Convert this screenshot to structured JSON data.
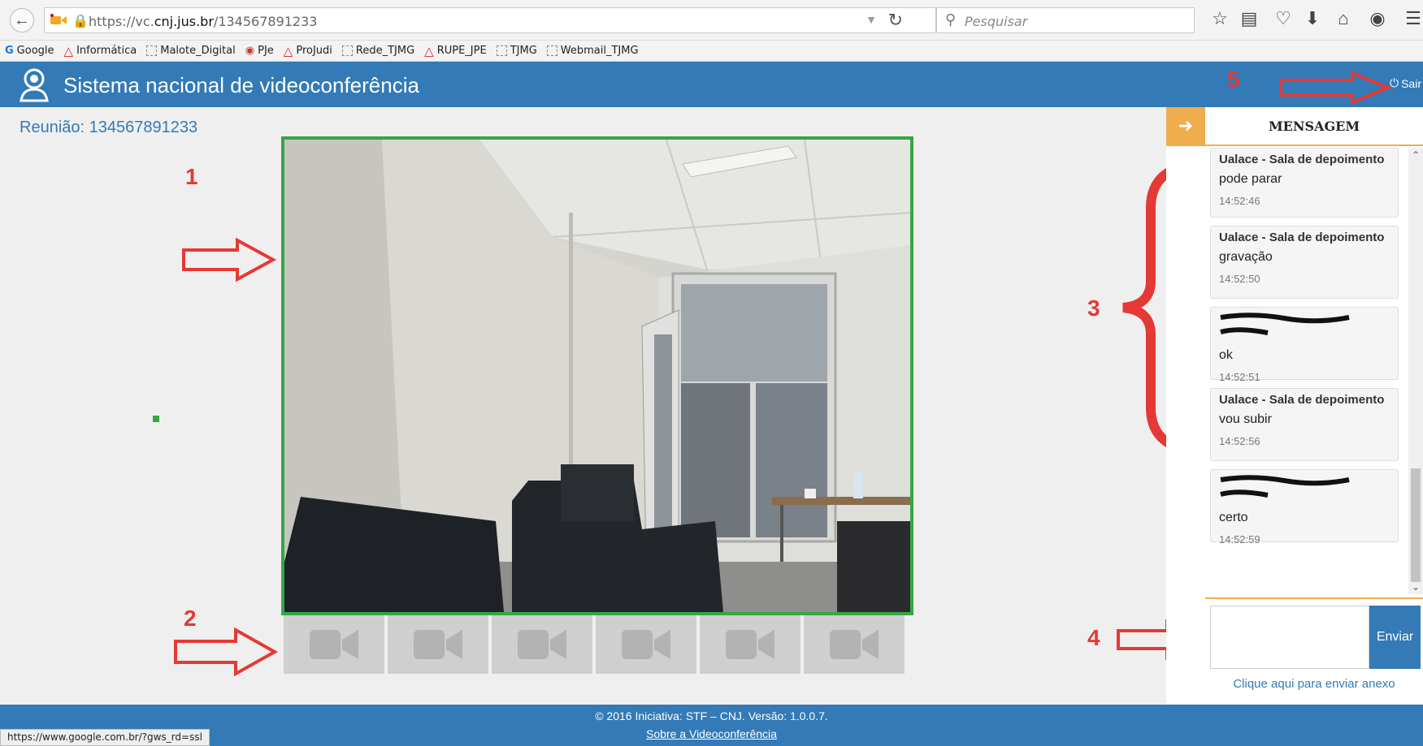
{
  "browser": {
    "url_prefix": "https://vc.",
    "url_domain": "cnj.jus.br",
    "url_path": "/134567891233",
    "search_placeholder": "Pesquisar",
    "status_url": "https://www.google.com.br/?gws_rd=ssl",
    "bookmarks": [
      {
        "label": "Google",
        "icon": "google-icon"
      },
      {
        "label": "Informática",
        "icon": "triangle-icon"
      },
      {
        "label": "Malote_Digital",
        "icon": "page-icon"
      },
      {
        "label": "PJe",
        "icon": "pje-icon"
      },
      {
        "label": "ProJudi",
        "icon": "triangle-icon"
      },
      {
        "label": "Rede_TJMG",
        "icon": "page-icon"
      },
      {
        "label": "RUPE_JPE",
        "icon": "triangle-icon"
      },
      {
        "label": "TJMG",
        "icon": "page-icon"
      },
      {
        "label": "Webmail_TJMG",
        "icon": "page-icon"
      }
    ]
  },
  "header": {
    "title": "Sistema nacional de videoconferência",
    "logout_label": "Sair",
    "color": "#337ab7"
  },
  "meeting": {
    "label": "Reunião: 134567891233"
  },
  "annotations": {
    "n1": "1",
    "n2": "2",
    "n3": "3",
    "n4": "4",
    "n5": "5",
    "color": "#e53935"
  },
  "thumbnails": [
    {
      "icon": "video-camera-icon"
    },
    {
      "icon": "video-camera-icon"
    },
    {
      "icon": "video-camera-icon"
    },
    {
      "icon": "video-camera-icon"
    },
    {
      "icon": "video-camera-icon"
    },
    {
      "icon": "video-camera-icon"
    }
  ],
  "chat": {
    "title": "MENSAGEM",
    "messages": [
      {
        "author": "Ualace - Sala de depoimento",
        "text": "pode parar",
        "time": "14:52:46",
        "redacted": false
      },
      {
        "author": "Ualace - Sala de depoimento",
        "text": "gravação",
        "time": "14:52:50",
        "redacted": false
      },
      {
        "author": "",
        "text": "ok",
        "time": "14:52:51",
        "redacted": true
      },
      {
        "author": "Ualace - Sala de depoimento",
        "text": "vou subir",
        "time": "14:52:56",
        "redacted": false
      },
      {
        "author": "",
        "text": "certo",
        "time": "14:52:59",
        "redacted": true
      }
    ],
    "send_label": "Enviar",
    "attach_label": "Clique aqui para enviar anexo",
    "input_value": ""
  },
  "footer": {
    "copyright": "© 2016 Iniciativa: STF – CNJ. Versão: 1.0.0.7.",
    "about_link": "Sobre a Videoconferência"
  }
}
